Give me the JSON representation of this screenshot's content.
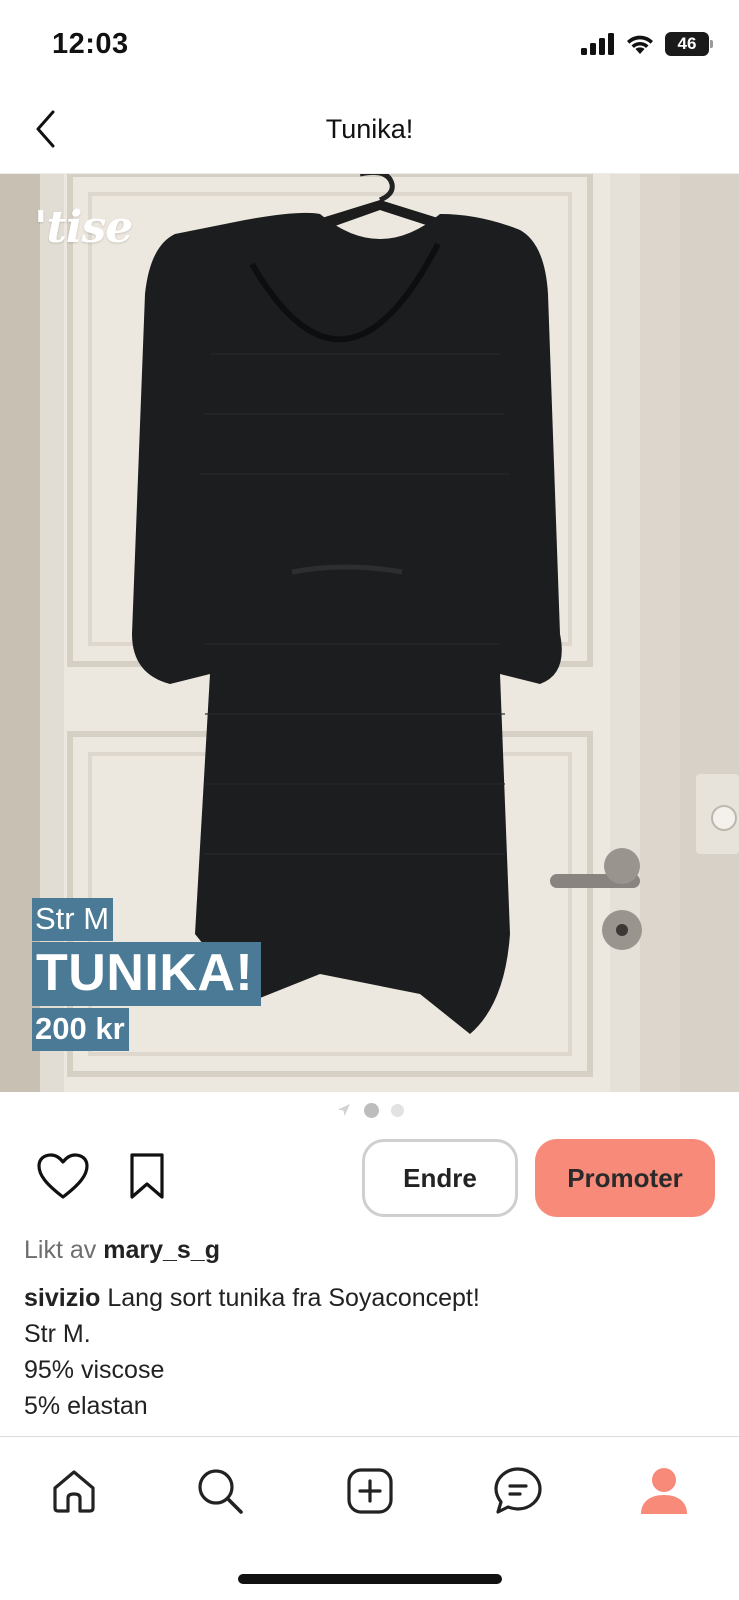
{
  "status_bar": {
    "time": "12:03",
    "battery": "46",
    "icons": [
      "signal-icon",
      "wifi-icon",
      "battery-icon"
    ]
  },
  "nav": {
    "title": "Tunika!",
    "back_icon": "chevron-left-icon"
  },
  "photo": {
    "logo": "'tise",
    "overlay_size": "Str M",
    "overlay_title": "TUNIKA!",
    "overlay_price": "200 kr",
    "overlay_color": "#4a7a96"
  },
  "pager": {
    "count": 2,
    "active_index": 0
  },
  "actions": {
    "like_icon": "heart-icon",
    "save_icon": "bookmark-icon",
    "edit_label": "Endre",
    "promote_label": "Promoter",
    "promote_color": "#f88a7a"
  },
  "liked": {
    "prefix": "Likt av",
    "user": "mary_s_g"
  },
  "description": {
    "seller": "sivizio",
    "lines": [
      "Lang sort tunika fra Soyaconcept!",
      "Str M.",
      "95% viscose",
      "5% elastan"
    ]
  },
  "tabbar": {
    "items": [
      "home-icon",
      "search-icon",
      "add-icon",
      "chat-icon",
      "profile-icon"
    ],
    "accent": "#f88a7a"
  }
}
